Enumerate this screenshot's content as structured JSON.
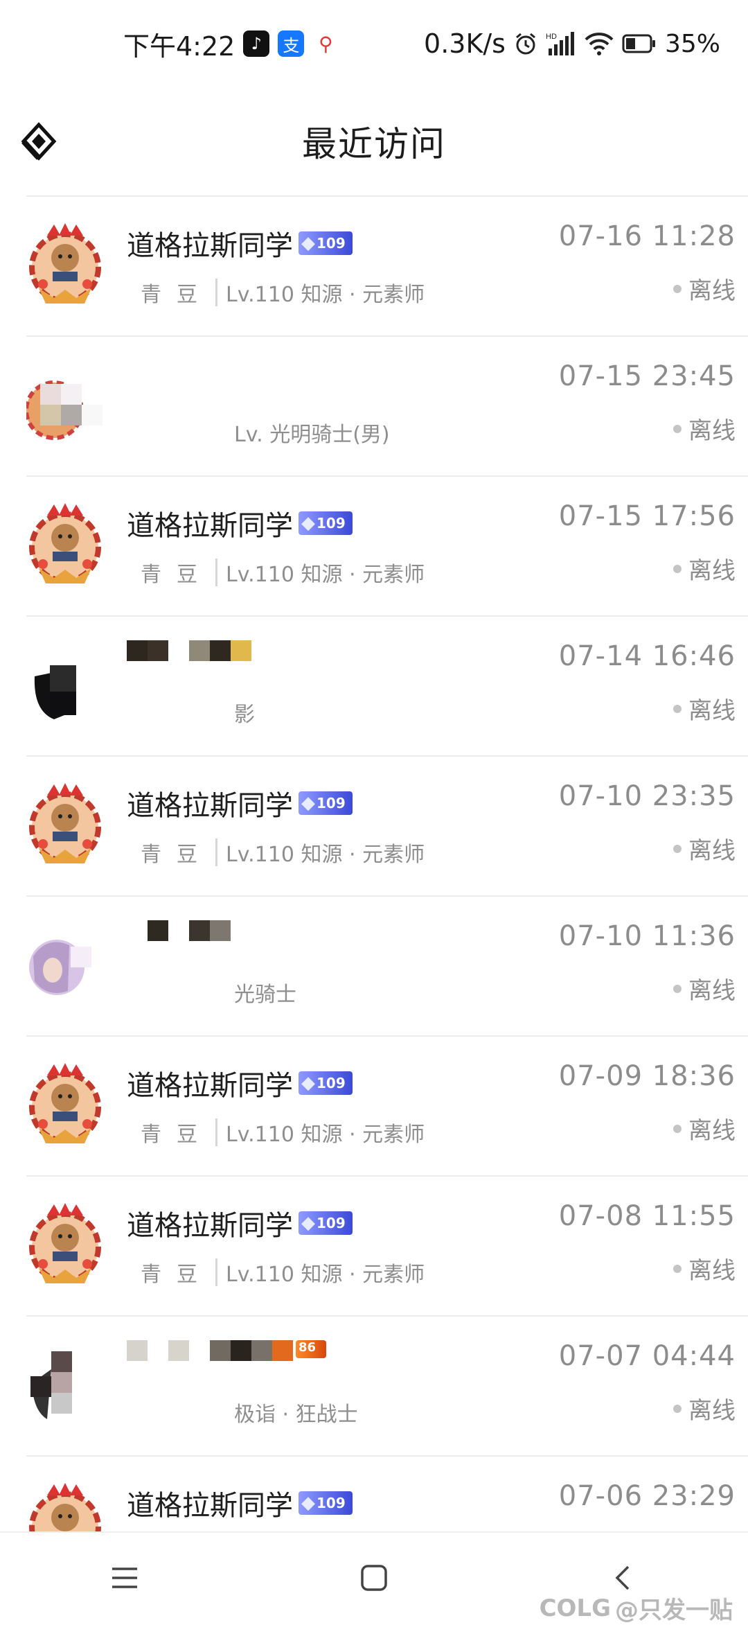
{
  "status_bar": {
    "time": "下午4:22",
    "net_speed": "0.3K/s",
    "hd_label": "HD",
    "battery": "35%"
  },
  "header": {
    "title": "最近访问"
  },
  "entries": [
    {
      "name": "道格拉斯同学",
      "badge": "109",
      "guild": "青豆",
      "info": "Lv.110 知源 · 元素师",
      "time": "07-16 11:28",
      "status": "离线",
      "avatar": "chibi"
    },
    {
      "name": "",
      "badge": "",
      "guild": "",
      "info": "Lv.     光明骑士(男)",
      "time": "07-15 23:45",
      "status": "离线",
      "avatar": "blurred"
    },
    {
      "name": "道格拉斯同学",
      "badge": "109",
      "guild": "青豆",
      "info": "Lv.110 知源 · 元素师",
      "time": "07-15 17:56",
      "status": "离线",
      "avatar": "chibi"
    },
    {
      "name": "",
      "badge": "",
      "guild": "",
      "info": "影",
      "time": "07-14 16:46",
      "status": "离线",
      "avatar": "dark"
    },
    {
      "name": "道格拉斯同学",
      "badge": "109",
      "guild": "青豆",
      "info": "Lv.110 知源 · 元素师",
      "time": "07-10 23:35",
      "status": "离线",
      "avatar": "chibi"
    },
    {
      "name": "",
      "badge": "",
      "guild": "",
      "info": "光骑士",
      "time": "07-10 11:36",
      "status": "离线",
      "avatar": "anime"
    },
    {
      "name": "道格拉斯同学",
      "badge": "109",
      "guild": "青豆",
      "info": "Lv.110 知源 · 元素师",
      "time": "07-09 18:36",
      "status": "离线",
      "avatar": "chibi"
    },
    {
      "name": "道格拉斯同学",
      "badge": "109",
      "guild": "青豆",
      "info": "Lv.110 知源 · 元素师",
      "time": "07-08 11:55",
      "status": "离线",
      "avatar": "chibi"
    },
    {
      "name": "",
      "badge": "86",
      "guild": "",
      "info": "极诣 · 狂战士",
      "time": "07-07 04:44",
      "status": "离线",
      "avatar": "dark2"
    },
    {
      "name": "道格拉斯同学",
      "badge": "109",
      "guild": "",
      "info": "",
      "time": "07-06 23:29",
      "status": "",
      "avatar": "chibi"
    }
  ],
  "watermark": "@只发一贴",
  "watermark_logo": "COLG",
  "colors": {
    "badge_blue": "#5a66e8",
    "badge_orange": "#e2590f",
    "offline_dot": "#c4c4c4"
  }
}
